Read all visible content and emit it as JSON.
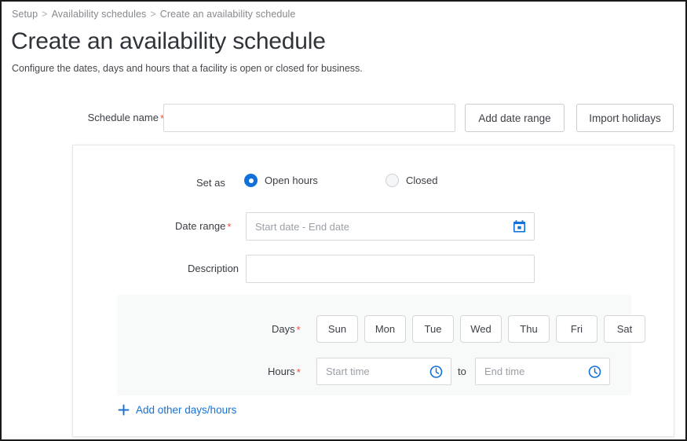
{
  "breadcrumb": {
    "items": [
      "Setup",
      "Availability schedules",
      "Create an availability schedule"
    ],
    "separator": ">"
  },
  "page": {
    "title": "Create an availability schedule",
    "subtitle": "Configure the dates, days and hours that a facility is open or closed for business."
  },
  "colors": {
    "accent": "#1271d8",
    "link": "#1871d4",
    "required_marker": "#e8503a",
    "subpanel_bg": "#f8f9f9",
    "border": "#d6d8da"
  },
  "name_row": {
    "label": "Schedule name",
    "required_marker": "*",
    "input_value": "",
    "input_placeholder": "",
    "add_date_range_label": "Add date range",
    "import_holidays_label": "Import holidays"
  },
  "card": {
    "set_as": {
      "label": "Set as",
      "options": [
        {
          "label": "Open hours",
          "selected": true
        },
        {
          "label": "Closed",
          "selected": false
        }
      ]
    },
    "date_range": {
      "label": "Date range",
      "required_marker": "*",
      "value": "",
      "placeholder": "Start date - End date",
      "icon": "calendar-icon"
    },
    "description": {
      "label": "Description",
      "value": "",
      "placeholder": ""
    },
    "days": {
      "label": "Days",
      "required_marker": "*",
      "options": [
        "Sun",
        "Mon",
        "Tue",
        "Wed",
        "Thu",
        "Fri",
        "Sat"
      ]
    },
    "hours": {
      "label": "Hours",
      "required_marker": "*",
      "start_value": "",
      "start_placeholder": "Start time",
      "separator": "to",
      "end_value": "",
      "end_placeholder": "End time",
      "icon": "clock-icon"
    },
    "add_other": {
      "label": "Add other days/hours",
      "icon": "plus-icon"
    }
  }
}
